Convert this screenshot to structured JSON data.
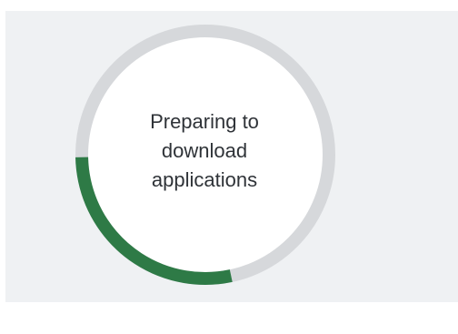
{
  "status": {
    "line1": "Preparing to",
    "line2": "download",
    "line3": "applications"
  },
  "progress": {
    "fraction": 0.28,
    "track_color": "#d6d8db",
    "fill_color": "#2e7a46",
    "inner_color": "#ffffff"
  },
  "colors": {
    "panel_background": "#eff1f3",
    "page_background": "#ffffff",
    "text": "#2f3338"
  }
}
